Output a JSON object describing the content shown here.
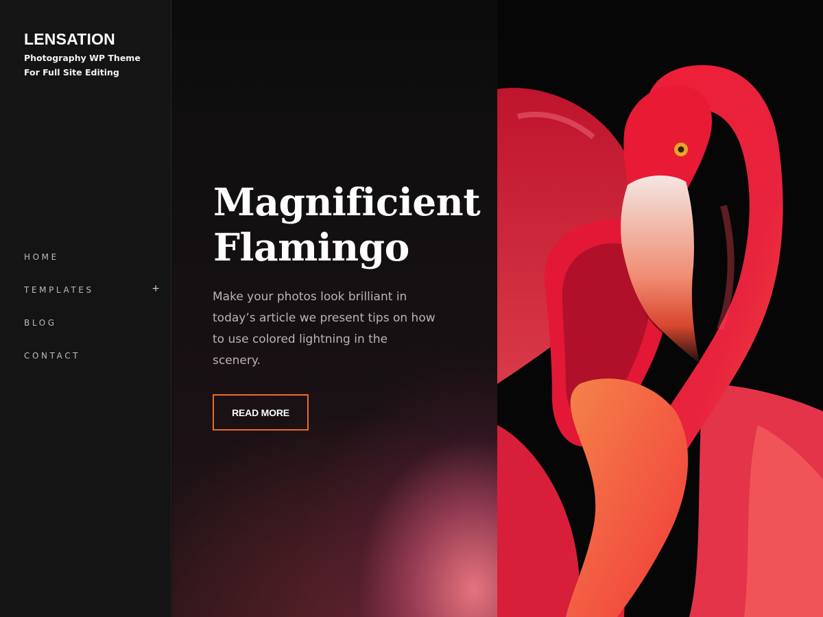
{
  "site": {
    "title": "LENSATION",
    "tagline": "Photography WP Theme For Full Site Editing"
  },
  "nav": {
    "items": [
      {
        "label": "HOME"
      },
      {
        "label": "TEMPLATES",
        "expand_icon": "+"
      },
      {
        "label": "BLOG"
      },
      {
        "label": "CONTACT"
      }
    ]
  },
  "hero": {
    "title": "Magnificient Flamingo",
    "text": "Make your photos look brilliant in today’s article we present tips on how to use colored lightning in the scenery.",
    "button_label": "READ MORE"
  },
  "colors": {
    "accent": "#ee6a1f",
    "sidebar_bg": "#141414",
    "hero_bg": "#0c0c0c"
  },
  "icons": {
    "submenu": "plus-icon"
  }
}
